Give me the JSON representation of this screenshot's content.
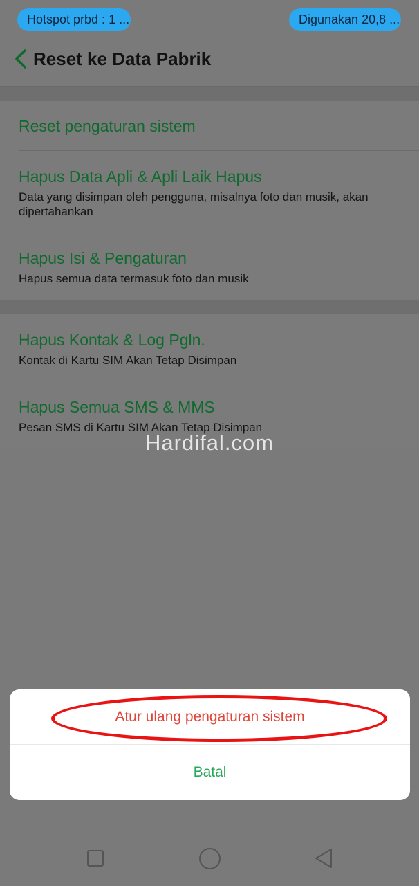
{
  "status_bar": {
    "hotspot": "Hotspot prbd : 1 ...",
    "usage": "Digunakan 20,8 ..."
  },
  "header": {
    "back_icon": "chevron-left-icon",
    "title": "Reset ke Data Pabrik"
  },
  "groups": [
    {
      "items": [
        {
          "title": "Reset pengaturan sistem",
          "subtitle": ""
        },
        {
          "title": "Hapus Data Apli & Apli Laik Hapus",
          "subtitle": "Data yang disimpan oleh pengguna, misalnya foto dan musik, akan dipertahankan"
        },
        {
          "title": "Hapus Isi & Pengaturan",
          "subtitle": "Hapus semua data termasuk foto dan musik"
        }
      ]
    },
    {
      "items": [
        {
          "title": "Hapus Kontak & Log Pgln.",
          "subtitle": "Kontak di Kartu SIM Akan Tetap Disimpan"
        },
        {
          "title": "Hapus Semua SMS & MMS",
          "subtitle": "Pesan SMS di Kartu SIM Akan Tetap Disimpan"
        }
      ]
    }
  ],
  "watermark": "Hardifal.com",
  "dialog": {
    "confirm_label": "Atur ulang pengaturan sistem",
    "cancel_label": "Batal"
  },
  "nav_bar": {
    "recents_icon": "square-icon",
    "home_icon": "circle-icon",
    "back_icon": "triangle-back-icon"
  },
  "colors": {
    "accent_green": "#2aa85a",
    "confirm_red": "#e0453a",
    "pill_blue": "#2ba8f0",
    "highlight_red": "#e81313"
  }
}
